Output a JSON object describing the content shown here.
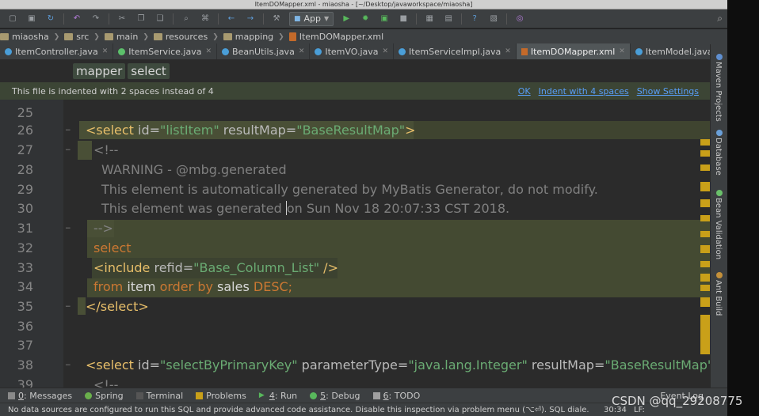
{
  "window_title": "ItemDOMapper.xml - miaosha - [~/Desktop/javaworkspace/miaosha]",
  "run_config": "App",
  "nav": [
    "miaosha",
    "src",
    "main",
    "resources",
    "mapping",
    "ItemDOMapper.xml"
  ],
  "tabs": [
    {
      "label": "ItemController.java",
      "type": "class"
    },
    {
      "label": "ItemService.java",
      "type": "interface"
    },
    {
      "label": "BeanUtils.java",
      "type": "class"
    },
    {
      "label": "ItemVO.java",
      "type": "class"
    },
    {
      "label": "ItemServiceImpl.java",
      "type": "class"
    },
    {
      "label": "ItemDOMapper.xml",
      "type": "xml",
      "active": true
    },
    {
      "label": "ItemModel.java",
      "type": "class"
    }
  ],
  "breadcrumbs": [
    "mapper",
    "select"
  ],
  "banner": {
    "message": "This file is indented with 2 spaces instead of 4",
    "ok": "OK",
    "indent": "Indent with 4 spaces",
    "settings": "Show Settings"
  },
  "lines": [
    {
      "n": "25"
    },
    {
      "n": "26"
    },
    {
      "n": "27"
    },
    {
      "n": "28"
    },
    {
      "n": "29"
    },
    {
      "n": "30"
    },
    {
      "n": "31"
    },
    {
      "n": "32"
    },
    {
      "n": "33"
    },
    {
      "n": "34"
    },
    {
      "n": "35"
    },
    {
      "n": "36"
    },
    {
      "n": "37"
    },
    {
      "n": "38"
    },
    {
      "n": "39"
    }
  ],
  "code": {
    "l26": {
      "tag_open": "<select",
      "attr1": " id=",
      "val1": "\"listItem\"",
      "attr2": " resultMap=",
      "val2": "\"BaseResultMap\"",
      "tag_close": ">"
    },
    "l27": "<!--",
    "l28": "WARNING - @mbg.generated",
    "l29": "This element is automatically generated by MyBatis Generator, do not modify.",
    "l30a": "This element was generated ",
    "l30b": "on Sun Nov 18 20:07:33 CST 2018.",
    "l31": "-->",
    "l32": "select",
    "l33": {
      "tag": "<include",
      "attr": " refid=",
      "val": "\"Base_Column_List\"",
      "close": " />"
    },
    "l34": {
      "k1": "from ",
      "p1": "item ",
      "k2": "order by ",
      "p2": "sales ",
      "k3": "DESC;"
    },
    "l35": "</select>",
    "l38": {
      "tag": "<select",
      "a1": " id=",
      "v1": "\"selectByPrimaryKey\"",
      "a2": " parameterType=",
      "v2": "\"java.lang.Integer\"",
      "a3": " resultMap=",
      "v3": "\"BaseResultMap\""
    },
    "l39": "<!--"
  },
  "right_tools": [
    "Maven Projects",
    "Database",
    "Bean Validation",
    "Ant Build"
  ],
  "bottom_tools": [
    {
      "num": "0",
      "label": ": Messages"
    },
    {
      "num": "",
      "label": "Spring"
    },
    {
      "num": "",
      "label": "Terminal"
    },
    {
      "num": "",
      "label": "Problems"
    },
    {
      "num": "4",
      "label": ": Run"
    },
    {
      "num": "5",
      "label": ": Debug"
    },
    {
      "num": "6",
      "label": ": TODO"
    }
  ],
  "event_log": "Event Log",
  "status_message": "No data sources are configured to run this SQL and provide advanced code assistance. Disable this inspection via problem menu (⌥⏎). SQL diale.",
  "cursor_pos": "30:34",
  "line_sep": "LF:",
  "watermark": "CSDN @qq_29208775"
}
